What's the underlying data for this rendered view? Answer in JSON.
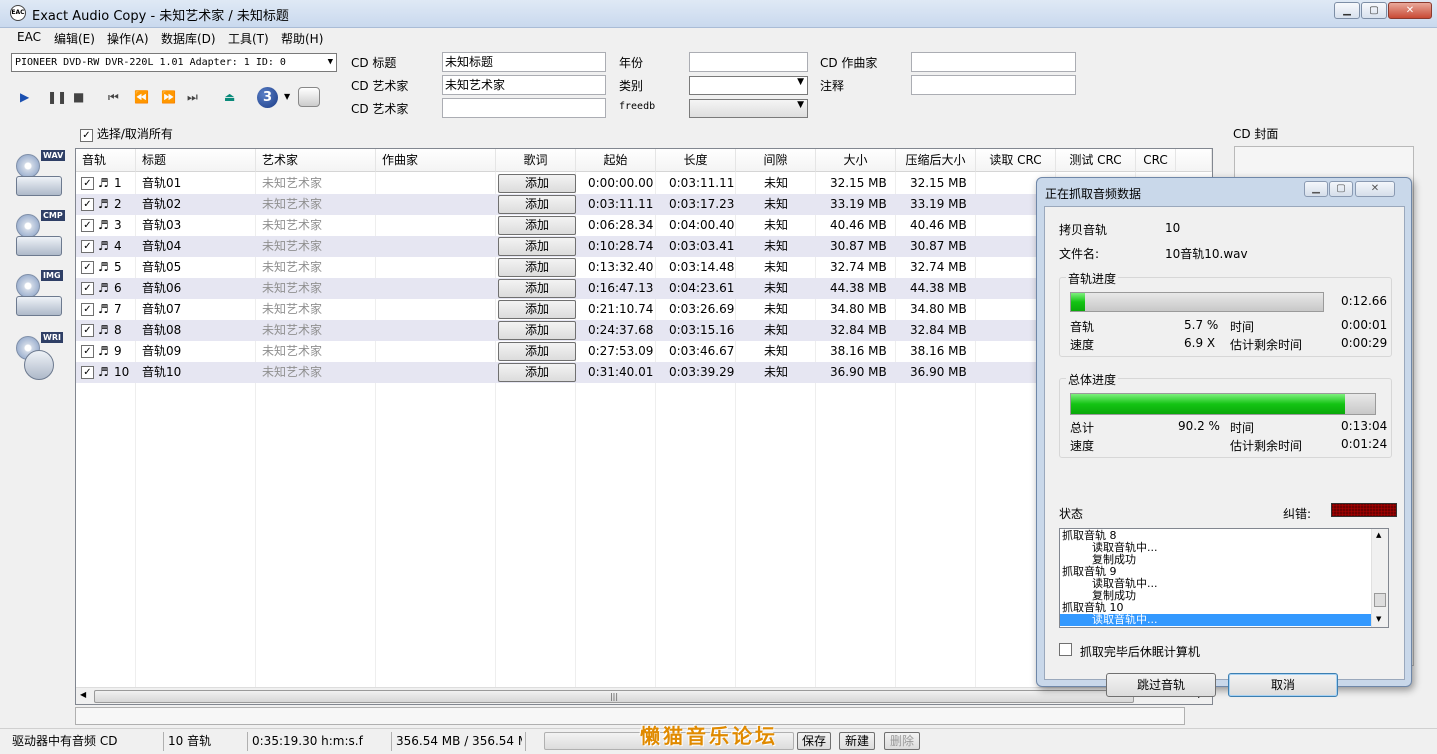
{
  "window": {
    "title": "Exact Audio Copy   -   未知艺术家 / 未知标题",
    "app_icon": "EAC"
  },
  "menu": [
    "EAC",
    "编辑(E)",
    "操作(A)",
    "数据库(D)",
    "工具(T)",
    "帮助(H)"
  ],
  "drive": {
    "selected": "PIONEER DVD-RW  DVR-220L 1.01   Adapter: 1  ID: 0"
  },
  "toolbar": {
    "speed": "3"
  },
  "cd_info": {
    "title_label": "CD 标题",
    "title_value": "未知标题",
    "artist_label": "CD 艺术家",
    "artist_value": "未知艺术家",
    "artist2_label": "CD 艺术家",
    "artist2_value": "",
    "year_label": "年份",
    "year_value": "",
    "genre_label": "类别",
    "genre_value": "",
    "freedb_label": "freedb",
    "freedb_value": "",
    "composer_label": "CD 作曲家",
    "composer_value": "",
    "comment_label": "注释",
    "comment_value": ""
  },
  "select_all_label": "选择/取消所有",
  "cover_label": "CD 封面",
  "side_tags": [
    "WAV",
    "CMP",
    "IMG",
    "WRI"
  ],
  "table": {
    "headers": [
      "音轨",
      "标题",
      "艺术家",
      "作曲家",
      "歌词",
      "起始",
      "长度",
      "间隙",
      "大小",
      "压缩后大小",
      "读取 CRC",
      "测试 CRC",
      "CRC"
    ],
    "add_label": "添加",
    "rows": [
      {
        "num": "1",
        "title": "音轨01",
        "artist": "未知艺术家",
        "start": "0:00:00.00",
        "length": "0:03:11.11",
        "gap": "未知",
        "size": "32.15 MB",
        "csize": "32.15 MB"
      },
      {
        "num": "2",
        "title": "音轨02",
        "artist": "未知艺术家",
        "start": "0:03:11.11",
        "length": "0:03:17.23",
        "gap": "未知",
        "size": "33.19 MB",
        "csize": "33.19 MB"
      },
      {
        "num": "3",
        "title": "音轨03",
        "artist": "未知艺术家",
        "start": "0:06:28.34",
        "length": "0:04:00.40",
        "gap": "未知",
        "size": "40.46 MB",
        "csize": "40.46 MB"
      },
      {
        "num": "4",
        "title": "音轨04",
        "artist": "未知艺术家",
        "start": "0:10:28.74",
        "length": "0:03:03.41",
        "gap": "未知",
        "size": "30.87 MB",
        "csize": "30.87 MB"
      },
      {
        "num": "5",
        "title": "音轨05",
        "artist": "未知艺术家",
        "start": "0:13:32.40",
        "length": "0:03:14.48",
        "gap": "未知",
        "size": "32.74 MB",
        "csize": "32.74 MB"
      },
      {
        "num": "6",
        "title": "音轨06",
        "artist": "未知艺术家",
        "start": "0:16:47.13",
        "length": "0:04:23.61",
        "gap": "未知",
        "size": "44.38 MB",
        "csize": "44.38 MB"
      },
      {
        "num": "7",
        "title": "音轨07",
        "artist": "未知艺术家",
        "start": "0:21:10.74",
        "length": "0:03:26.69",
        "gap": "未知",
        "size": "34.80 MB",
        "csize": "34.80 MB"
      },
      {
        "num": "8",
        "title": "音轨08",
        "artist": "未知艺术家",
        "start": "0:24:37.68",
        "length": "0:03:15.16",
        "gap": "未知",
        "size": "32.84 MB",
        "csize": "32.84 MB"
      },
      {
        "num": "9",
        "title": "音轨09",
        "artist": "未知艺术家",
        "start": "0:27:53.09",
        "length": "0:03:46.67",
        "gap": "未知",
        "size": "38.16 MB",
        "csize": "38.16 MB"
      },
      {
        "num": "10",
        "title": "音轨10",
        "artist": "未知艺术家",
        "start": "0:31:40.01",
        "length": "0:03:39.29",
        "gap": "未知",
        "size": "36.90 MB",
        "csize": "36.90 MB"
      }
    ]
  },
  "statusbar": {
    "drive_status": "驱动器中有音频 CD",
    "track_count": "10 音轨",
    "total_time": "0:35:19.30 h:m:s.f",
    "total_size": "356.54 MB / 356.54 M",
    "save": "保存",
    "new": "新建",
    "delete": "删除",
    "watermark": "懒猫音乐论坛"
  },
  "dialog": {
    "title": "正在抓取音频数据",
    "copy_track_label": "拷贝音轨",
    "copy_track_value": "10",
    "filename_label": "文件名:",
    "filename_value": "10音轨10.wav",
    "track_progress": {
      "group": "音轨进度",
      "percent": 5.7,
      "elapsed_top": "0:12.66",
      "track_label": "音轨",
      "track_pct": "5.7 %",
      "time_label": "时间",
      "time_value": "0:00:01",
      "speed_label": "速度",
      "speed_value": "6.9 X",
      "remain_label": "估计剩余时间",
      "remain_value": "0:00:29"
    },
    "total_progress": {
      "group": "总体进度",
      "percent": 90.2,
      "total_label": "总计",
      "total_pct": "90.2 %",
      "time_label": "时间",
      "time_value": "0:13:04",
      "speed_label": "速度",
      "remain_label": "估计剩余时间",
      "remain_value": "0:01:24"
    },
    "status_label": "状态",
    "error_label": "纠错:",
    "log": [
      "抓取音轨  8",
      "读取音轨中...",
      "复制成功",
      "抓取音轨  9",
      "读取音轨中...",
      "复制成功",
      "抓取音轨  10",
      "读取音轨中..."
    ],
    "sleep_label": "抓取完毕后休眠计算机",
    "skip_button": "跳过音轨",
    "cancel_button": "取消"
  }
}
